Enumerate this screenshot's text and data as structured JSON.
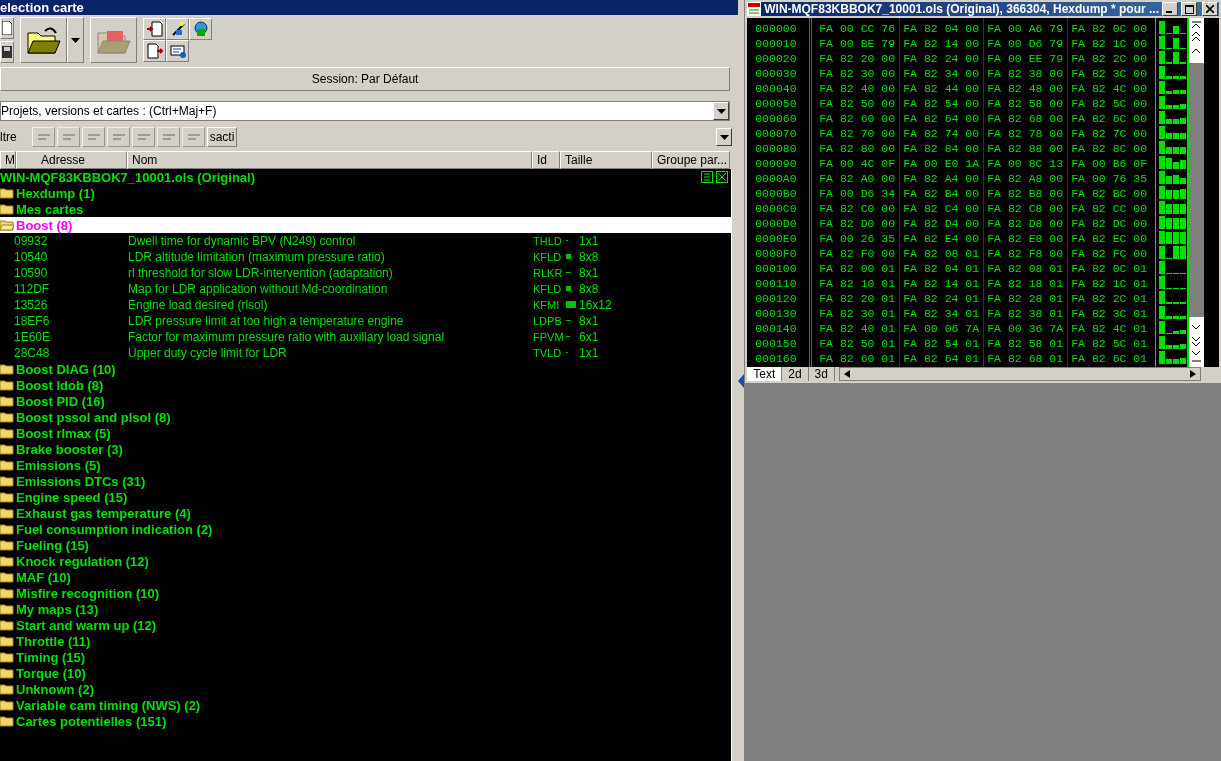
{
  "left_window": {
    "title": "election carte"
  },
  "session": "Session: Par Défaut",
  "search": {
    "value": "Projets, versions et cartes :  (Ctrl+Maj+F)"
  },
  "filter": {
    "label": "ltre",
    "toggle": "sacti"
  },
  "columns": [
    "M",
    "Adresse",
    "Nom",
    "Id",
    "Taille",
    "Groupe par..."
  ],
  "tree": {
    "label": "WIN-MQF83KBBOK7_10001.ols (Original)",
    "children": [
      {
        "label": "Hexdump (1)",
        "selected": false,
        "expanded": false
      },
      {
        "label": "Mes cartes",
        "selected": false,
        "expanded": false
      },
      {
        "label": "Boost (8)",
        "selected": true,
        "expanded": true,
        "children": [
          {
            "address": "09932",
            "name": "Dwell time for dynamic BPV (N249) control",
            "id": "THLD",
            "size": "1x1"
          },
          {
            "address": "10540",
            "name": "LDR altitude limitation (maximum pressure ratio)",
            "id": "KFLD",
            "size": "8x8"
          },
          {
            "address": "10590",
            "name": "rl threshold for slow LDR-intervention (adaptation)",
            "id": "RLKR",
            "size": "8x1"
          },
          {
            "address": "112DF",
            "name": "Map for LDR application without Md-coordination",
            "id": "KFLD",
            "size": "8x8"
          },
          {
            "address": "13526",
            "name": "Engine load desired (rlsol)",
            "id": "KFMI",
            "size": "16x12"
          },
          {
            "address": "18EF6",
            "name": "LDR pressure limit at too high a temperature engine",
            "id": "LDPB",
            "size": "8x1"
          },
          {
            "address": "1E60E",
            "name": "Factor for maximum pressure ratio with auxillary load signal",
            "id": "FPVM",
            "size": "6x1"
          },
          {
            "address": "28C48",
            "name": "Upper duty cycle limit for LDR",
            "id": "TVLD",
            "size": "1x1"
          }
        ]
      },
      {
        "label": "Boost DIAG (10)",
        "selected": false,
        "expanded": false
      },
      {
        "label": "Boost ldob (8)",
        "selected": false,
        "expanded": false
      },
      {
        "label": "Boost PID (16)",
        "selected": false,
        "expanded": false
      },
      {
        "label": "Boost pssol and plsol (8)",
        "selected": false,
        "expanded": false
      },
      {
        "label": "Boost rlmax (5)",
        "selected": false,
        "expanded": false
      },
      {
        "label": "Brake booster (3)",
        "selected": false,
        "expanded": false
      },
      {
        "label": "Emissions (5)",
        "selected": false,
        "expanded": false
      },
      {
        "label": "Emissions DTCs (31)",
        "selected": false,
        "expanded": false
      },
      {
        "label": "Engine speed (15)",
        "selected": false,
        "expanded": false
      },
      {
        "label": "Exhaust gas temperature (4)",
        "selected": false,
        "expanded": false
      },
      {
        "label": "Fuel consumption indication (2)",
        "selected": false,
        "expanded": false
      },
      {
        "label": "Fueling (15)",
        "selected": false,
        "expanded": false
      },
      {
        "label": "Knock regulation (12)",
        "selected": false,
        "expanded": false
      },
      {
        "label": "MAF (10)",
        "selected": false,
        "expanded": false
      },
      {
        "label": "Misfire recognition (10)",
        "selected": false,
        "expanded": false
      },
      {
        "label": "My maps (13)",
        "selected": false,
        "expanded": false
      },
      {
        "label": "Start and warm up (12)",
        "selected": false,
        "expanded": false
      },
      {
        "label": "Throttle (11)",
        "selected": false,
        "expanded": false
      },
      {
        "label": "Timing (15)",
        "selected": false,
        "expanded": false
      },
      {
        "label": "Torque (10)",
        "selected": false,
        "expanded": false
      },
      {
        "label": "Unknown (2)",
        "selected": false,
        "expanded": false
      },
      {
        "label": "Variable cam timing (NWS) (2)",
        "selected": false,
        "expanded": false
      },
      {
        "label": "Cartes potentielles (151)",
        "selected": false,
        "expanded": false
      }
    ]
  },
  "hexdump": {
    "title": "WIN-MQF83KBBOK7_10001.ols (Original), 366304, Hexdump * pour ...",
    "rows": [
      {
        "address": "000000",
        "groups": [
          "FA 00 CC 76",
          "FA 82 04 00",
          "FA 00 A6 79",
          "FA 82 0C 00"
        ]
      },
      {
        "address": "000010",
        "groups": [
          "FA 00 BE 79",
          "FA 82 14 00",
          "FA 00 D6 79",
          "FA 82 1C 00"
        ]
      },
      {
        "address": "000020",
        "groups": [
          "FA 82 20 00",
          "FA 82 24 00",
          "FA 00 EE 79",
          "FA 82 2C 00"
        ]
      },
      {
        "address": "000030",
        "groups": [
          "FA 82 30 00",
          "FA 82 34 00",
          "FA 82 38 00",
          "FA 82 3C 00"
        ]
      },
      {
        "address": "000040",
        "groups": [
          "FA 82 40 00",
          "FA 82 44 00",
          "FA 82 48 00",
          "FA 82 4C 00"
        ]
      },
      {
        "address": "000050",
        "groups": [
          "FA 82 50 00",
          "FA 82 54 00",
          "FA 82 58 00",
          "FA 82 5C 00"
        ]
      },
      {
        "address": "000060",
        "groups": [
          "FA 82 60 00",
          "FA 82 64 00",
          "FA 82 68 00",
          "FA 82 6C 00"
        ]
      },
      {
        "address": "000070",
        "groups": [
          "FA 82 70 00",
          "FA 82 74 00",
          "FA 82 78 00",
          "FA 82 7C 00"
        ]
      },
      {
        "address": "000080",
        "groups": [
          "FA 82 80 00",
          "FA 82 84 00",
          "FA 82 88 00",
          "FA 82 8C 00"
        ]
      },
      {
        "address": "000090",
        "groups": [
          "FA 00 4C 0F",
          "FA 00 E0 1A",
          "FA 00 8C 13",
          "FA 00 B6 0F"
        ]
      },
      {
        "address": "0000A0",
        "groups": [
          "FA 82 A0 00",
          "FA 82 A4 00",
          "FA 82 A8 00",
          "FA 00 76 35"
        ]
      },
      {
        "address": "0000B0",
        "groups": [
          "FA 00 D6 34",
          "FA 82 B4 00",
          "FA 82 B8 00",
          "FA 82 BC 00"
        ]
      },
      {
        "address": "0000C0",
        "groups": [
          "FA 82 C0 00",
          "FA 82 C4 00",
          "FA 82 C8 00",
          "FA 82 CC 00"
        ]
      },
      {
        "address": "0000D0",
        "groups": [
          "FA 82 D0 00",
          "FA 82 D4 00",
          "FA 82 D8 00",
          "FA 82 DC 00"
        ]
      },
      {
        "address": "0000E0",
        "groups": [
          "FA 00 26 35",
          "FA 82 E4 00",
          "FA 82 E8 00",
          "FA 82 EC 00"
        ]
      },
      {
        "address": "0000F0",
        "groups": [
          "FA 82 F0 00",
          "FA 82 08 01",
          "FA 82 F8 00",
          "FA 82 FC 00"
        ]
      },
      {
        "address": "000100",
        "groups": [
          "FA 82 00 01",
          "FA 82 04 01",
          "FA 82 08 01",
          "FA 82 0C 01"
        ]
      },
      {
        "address": "000110",
        "groups": [
          "FA 82 10 01",
          "FA 82 14 01",
          "FA 82 18 01",
          "FA 82 1C 01"
        ]
      },
      {
        "address": "000120",
        "groups": [
          "FA 82 20 01",
          "FA 82 24 01",
          "FA 82 28 01",
          "FA 82 2C 01"
        ]
      },
      {
        "address": "000130",
        "groups": [
          "FA 82 30 01",
          "FA 82 34 01",
          "FA 82 38 01",
          "FA 82 3C 01"
        ]
      },
      {
        "address": "000140",
        "groups": [
          "FA 82 40 01",
          "FA 00 06 7A",
          "FA 00 36 7A",
          "FA 82 4C 01"
        ]
      },
      {
        "address": "000150",
        "groups": [
          "FA 82 50 01",
          "FA 82 54 01",
          "FA 82 58 01",
          "FA 82 5C 01"
        ]
      },
      {
        "address": "000160",
        "groups": [
          "FA 82 60 01",
          "FA 82 64 01",
          "FA 82 68 01",
          "FA 82 6C 01"
        ]
      }
    ],
    "tabs": [
      {
        "label": "Text",
        "selected": true
      },
      {
        "label": "2d",
        "selected": false
      },
      {
        "label": "3d",
        "selected": false
      }
    ]
  }
}
